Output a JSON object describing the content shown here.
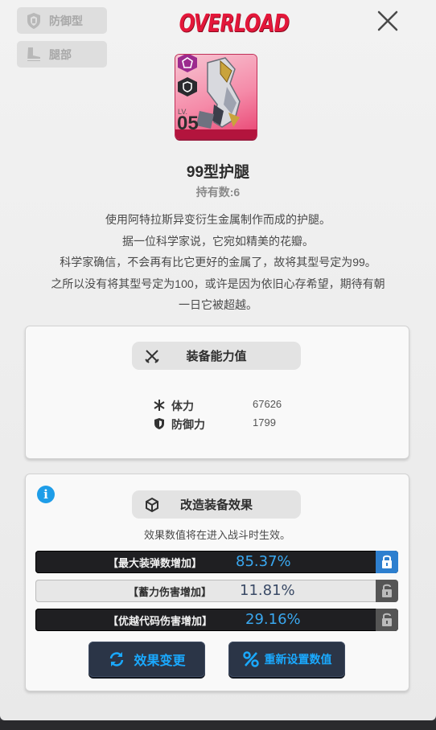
{
  "header": {
    "brand": "OVERLOAD",
    "tags": [
      {
        "icon": "shield-badge-icon",
        "label": "防御型"
      },
      {
        "icon": "boot-icon",
        "label": "腿部"
      }
    ]
  },
  "item": {
    "level_prefix": "LV.",
    "level": "05",
    "name": "99型护腿",
    "owned": "持有数:6",
    "description": [
      "使用阿特拉斯异变衍生金属制作而成的护腿。",
      "据一位科学家说，它宛如精美的花瓣。",
      "科学家确信，不会再有比它更好的金属了，故将其型号定为99。",
      "之所以没有将其型号定为100，或许是因为依旧心存希望，期待有朝",
      "一日它被超越。"
    ]
  },
  "stats_section": {
    "title": "装备能力值",
    "stats": [
      {
        "icon": "asterisk-icon",
        "label": "体力",
        "value": "67626"
      },
      {
        "icon": "shield-icon",
        "label": "防御力",
        "value": "1799"
      }
    ]
  },
  "effects_section": {
    "title": "改造装备效果",
    "note": "效果数值将在进入战斗时生效。",
    "effects": [
      {
        "label": "【最大装弹数增加】",
        "value": "85.37%",
        "locked": true,
        "style": "dark",
        "value_color": "#3aa8f0"
      },
      {
        "label": "【蓄力伤害增加】",
        "value": "11.81%",
        "locked": false,
        "style": "light",
        "value_color": "#3a4a66"
      },
      {
        "label": "【优越代码伤害增加】",
        "value": "29.16%",
        "locked": false,
        "style": "dark",
        "value_color": "#3aa8f0"
      }
    ],
    "buttons": {
      "change": "效果变更",
      "reset": "重新设置数值"
    }
  },
  "colors": {
    "brand": "#e3173a",
    "accent": "#1aa9ff",
    "card": "#f58aa8"
  }
}
